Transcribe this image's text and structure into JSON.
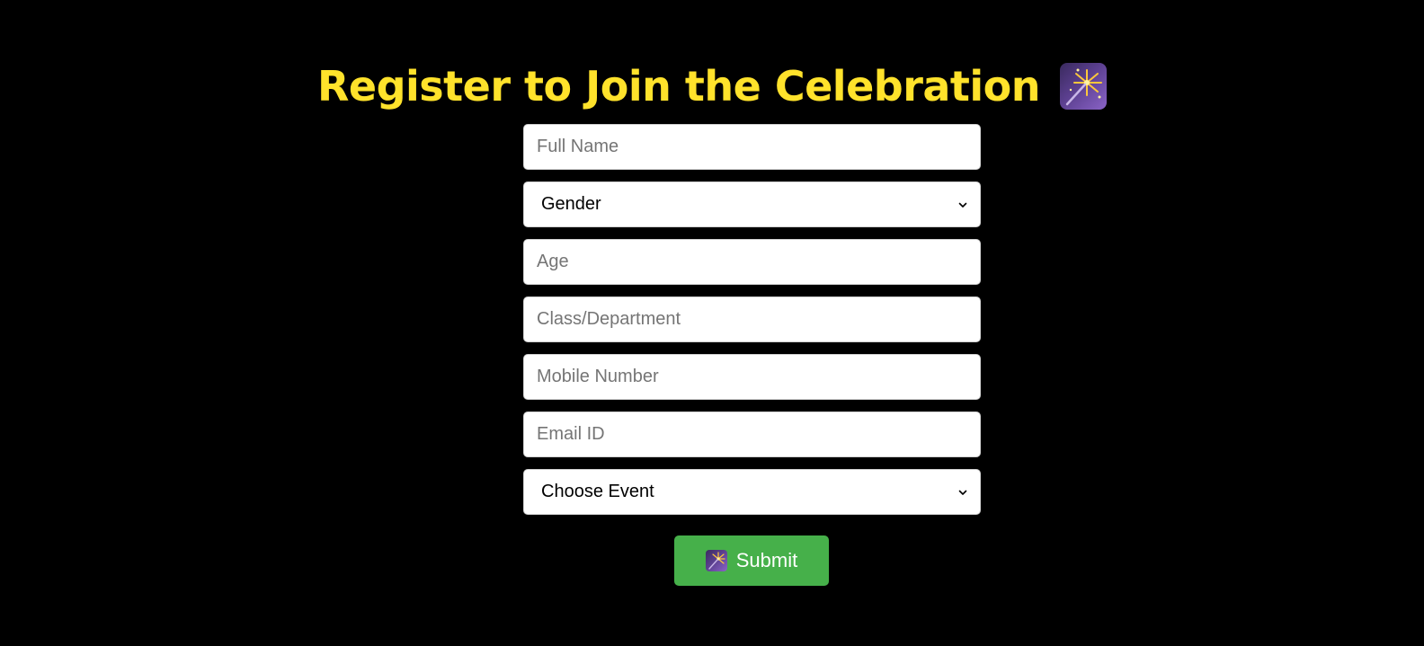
{
  "header": {
    "title": "Register to Join the Celebration",
    "title_icon": "sparkler-icon",
    "title_color": "#ffe22b"
  },
  "form": {
    "full_name": {
      "placeholder": "Full Name",
      "value": ""
    },
    "gender": {
      "selected": "Gender"
    },
    "age": {
      "placeholder": "Age",
      "value": ""
    },
    "class_department": {
      "placeholder": "Class/Department",
      "value": ""
    },
    "mobile": {
      "placeholder": "Mobile Number",
      "value": ""
    },
    "email": {
      "placeholder": "Email ID",
      "value": ""
    },
    "event": {
      "selected": "Choose Event"
    },
    "submit_label": "Submit",
    "submit_icon": "sparkler-icon"
  },
  "colors": {
    "background": "#000000",
    "accent": "#ffe22b",
    "button": "#46b04a",
    "button_text": "#ffffff"
  }
}
